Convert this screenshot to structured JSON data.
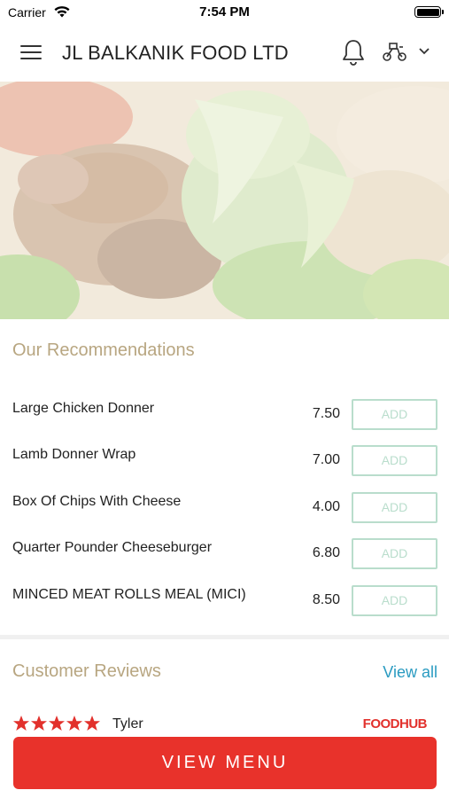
{
  "status_bar": {
    "carrier": "Carrier",
    "time": "7:54 PM",
    "icons": [
      "wifi-icon",
      "battery-icon"
    ]
  },
  "header": {
    "title": "JL BALKANIK FOOD LTD",
    "icons": [
      "hamburger-menu-icon",
      "bell-icon",
      "delivery-scooter-icon",
      "chevron-down-icon"
    ]
  },
  "hero": {
    "description_icon": "food-photo"
  },
  "recommendations": {
    "title": "Our Recommendations",
    "add_label": "ADD",
    "items": [
      {
        "name": "Large Chicken Donner",
        "price": "7.50"
      },
      {
        "name": "Lamb Donner Wrap",
        "price": "7.00"
      },
      {
        "name": "Box Of Chips With Cheese",
        "price": "4.00"
      },
      {
        "name": "Quarter Pounder Cheeseburger",
        "price": "6.80"
      },
      {
        "name": "MINCED MEAT ROLLS MEAL (MICI)",
        "price": "8.50"
      }
    ]
  },
  "reviews": {
    "title": "Customer Reviews",
    "view_all": "View all",
    "first": {
      "rating": 5,
      "reviewer": "Tyler",
      "source": "FOODHUB"
    }
  },
  "cta": {
    "label": "VIEW MENU"
  },
  "colors": {
    "accent_red": "#e8322b",
    "section_title": "#b8a681",
    "link_blue": "#2a9bc1",
    "add_green": "#b9ddcc"
  }
}
